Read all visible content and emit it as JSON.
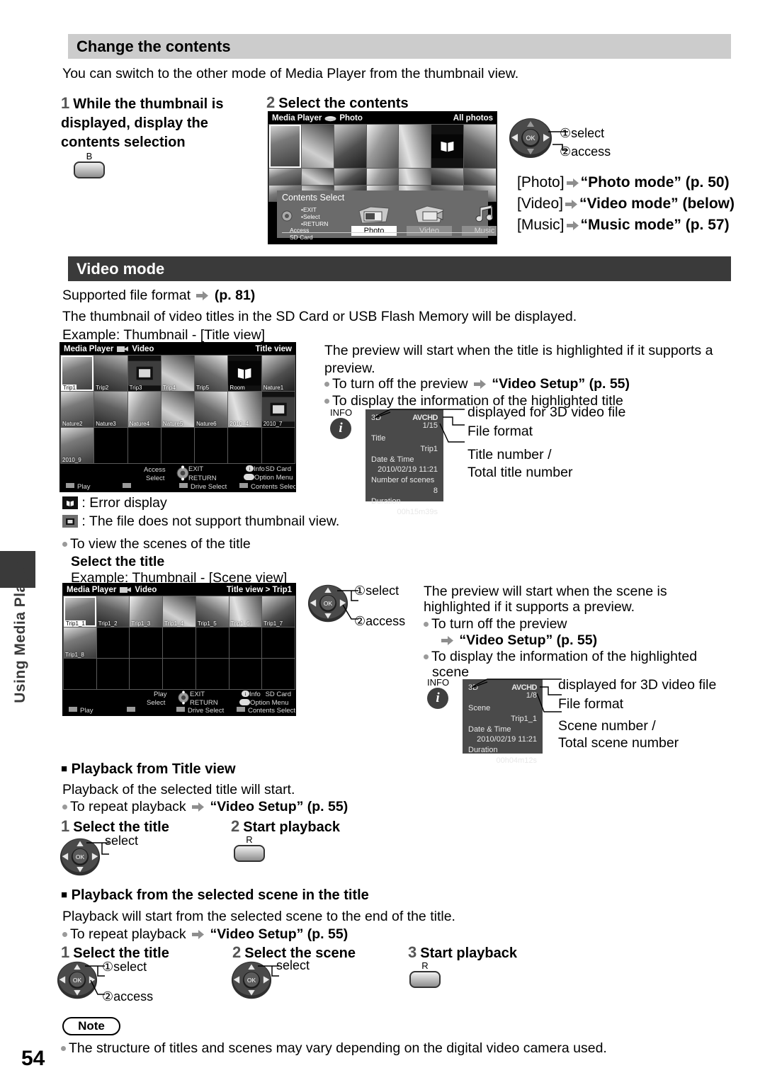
{
  "sidebar": {
    "tab_label": "Using Media Player"
  },
  "sections": {
    "change_contents": {
      "heading": "Change the contents",
      "intro": "You can switch to the other mode of Media Player from the thumbnail view.",
      "step1": {
        "num": "1",
        "text": "While the thumbnail is displayed, display the contents selection",
        "button_label": "B"
      },
      "step2": {
        "num": "2",
        "text": "Select the contents",
        "dpad_note1": "select",
        "dpad_note1_num": "①",
        "dpad_note2": "access",
        "dpad_note2_num": "②"
      },
      "mode_links": [
        {
          "bracket": "[Photo]",
          "label": "“Photo mode”",
          "page": "(p. 50)"
        },
        {
          "bracket": "[Video]",
          "label": "“Video mode”",
          "page": "(below)"
        },
        {
          "bracket": "[Music]",
          "label": "“Music mode”",
          "page": "(p. 57)"
        }
      ]
    },
    "video_mode": {
      "heading": "Video mode",
      "supported": "Supported file format",
      "supported_page": "(p. 81)",
      "thumb_line": "The thumbnail of video titles in the SD Card or USB Flash Memory will be displayed.",
      "example_title": "Example: Thumbnail - [Title view]",
      "example_scene": "Example: Thumbnail - [Scene view]",
      "preview_title": "The preview will start when the title is highlighted if it supports a preview.",
      "bullet_turnoff": "To turn off the preview",
      "video_setup": "“Video Setup”",
      "video_setup_page": "(p. 55)",
      "bullet_info_title": "To display the information of the highlighted title",
      "error_display": ": Error display",
      "no_thumb": ": The file does not support thumbnail view.",
      "bullet_view_scenes": "To view the scenes of the title",
      "select_title": "Select the title",
      "preview_scene_l1": "The preview will start when the scene is",
      "preview_scene_l2": "highlighted if it supports a preview.",
      "bullet_info_scene_l1": "To display the information of the highlighted",
      "bullet_info_scene_l2": "scene"
    }
  },
  "title_view_screen": {
    "app_name": "Media Player",
    "mode": "Video",
    "view_label": "Title view",
    "thumbs": [
      {
        "label": "Trip1",
        "kind": "photo",
        "selected": true
      },
      {
        "label": "Trip2",
        "kind": "photo"
      },
      {
        "label": "Trip3",
        "kind": "nothumb"
      },
      {
        "label": "Trip4",
        "kind": "photo"
      },
      {
        "label": "Trip5",
        "kind": "photo"
      },
      {
        "label": "Room",
        "kind": "error"
      },
      {
        "label": "Nature1",
        "kind": "photo"
      },
      {
        "label": "Nature2",
        "kind": "photo"
      },
      {
        "label": "Nature3",
        "kind": "photo"
      },
      {
        "label": "Nature4",
        "kind": "photo"
      },
      {
        "label": "Nature5",
        "kind": "photo"
      },
      {
        "label": "Nature6",
        "kind": "photo"
      },
      {
        "label": "2010_4",
        "kind": "photo"
      },
      {
        "label": "2010_7",
        "kind": "nothumb"
      },
      {
        "label": "2010_9",
        "kind": "photo"
      },
      {
        "label": "",
        "kind": "empty"
      },
      {
        "label": "",
        "kind": "empty"
      },
      {
        "label": "",
        "kind": "empty"
      },
      {
        "label": "",
        "kind": "empty"
      },
      {
        "label": "",
        "kind": "empty"
      },
      {
        "label": "",
        "kind": "empty"
      }
    ],
    "footer": {
      "access": "Access",
      "select": "Select",
      "exit": "EXIT",
      "return": "RETURN",
      "info": "Info",
      "option_menu": "Option Menu",
      "drive": "SD Card",
      "play": "Play",
      "drive_select": "Drive Select",
      "contents_select": "Contents Select"
    }
  },
  "scene_view_screen": {
    "app_name": "Media Player",
    "mode": "Video",
    "view_label": "Title view  >  Trip1",
    "thumbs": [
      {
        "label": "Trip1_1",
        "kind": "photo",
        "selected": true
      },
      {
        "label": "Trip1_2",
        "kind": "photo"
      },
      {
        "label": "Trip1_3",
        "kind": "photo"
      },
      {
        "label": "Trip1_4",
        "kind": "photo"
      },
      {
        "label": "Trip1_5",
        "kind": "photo"
      },
      {
        "label": "Trip1_6",
        "kind": "photo"
      },
      {
        "label": "Trip1_7",
        "kind": "photo"
      },
      {
        "label": "Trip1_8",
        "kind": "photo"
      },
      {
        "label": "",
        "kind": "empty"
      },
      {
        "label": "",
        "kind": "empty"
      },
      {
        "label": "",
        "kind": "empty"
      },
      {
        "label": "",
        "kind": "empty"
      },
      {
        "label": "",
        "kind": "empty"
      },
      {
        "label": "",
        "kind": "empty"
      },
      {
        "label": "",
        "kind": "empty"
      },
      {
        "label": "",
        "kind": "empty"
      },
      {
        "label": "",
        "kind": "empty"
      },
      {
        "label": "",
        "kind": "empty"
      },
      {
        "label": "",
        "kind": "empty"
      },
      {
        "label": "",
        "kind": "empty"
      },
      {
        "label": "",
        "kind": "empty"
      }
    ],
    "footer": {
      "access": "Play",
      "select": "Select",
      "exit": "EXIT",
      "return": "RETURN",
      "info": "Info",
      "option_menu": "Option Menu",
      "drive": "SD Card",
      "play": "Play",
      "drive_select": "Drive Select",
      "contents_select": "Contents Select"
    }
  },
  "photo_screen": {
    "app_name": "Media Player",
    "mode": "Photo",
    "view_label": "All photos",
    "overlay_title": "Contents Select",
    "overlay_hints": {
      "exit": "EXIT",
      "select": "Select",
      "return": "RETURN",
      "access": "Access",
      "drive": "SD Card"
    },
    "options": [
      {
        "label": "Photo",
        "selected": true
      },
      {
        "label": "Video",
        "selected": false
      },
      {
        "label": "Music",
        "selected": false
      }
    ]
  },
  "info_title": {
    "badge": "INFO",
    "flag_3d": "3D",
    "format": "AVCHD",
    "counter": "1/15",
    "rows": [
      {
        "key": "Title",
        "val": "Trip1"
      },
      {
        "key": "Date & Time",
        "val": "2010/02/19 11:21"
      },
      {
        "key": "Number of scenes",
        "val": "8"
      },
      {
        "key": "Duration",
        "val": "00h15m39s"
      }
    ],
    "callouts": {
      "three_d": "displayed for 3D video file",
      "format": "File format",
      "number_l1": "Title number /",
      "number_l2": "Total title number"
    }
  },
  "info_scene": {
    "badge": "INFO",
    "flag_3d": "3D",
    "format": "AVCHD",
    "counter": "1/8",
    "rows": [
      {
        "key": "Scene",
        "val": "Trip1_1"
      },
      {
        "key": "Date & Time",
        "val": "2010/02/19 11:21"
      },
      {
        "key": "Duration",
        "val": "00h04m12s"
      }
    ],
    "callouts": {
      "three_d": "displayed for 3D video file",
      "format": "File format",
      "number_l1": "Scene number /",
      "number_l2": "Total scene number"
    }
  },
  "playback_title": {
    "heading": "Playback from Title view",
    "body": "Playback of the selected title will start.",
    "bullet_repeat": "To repeat playback",
    "video_setup": "“Video Setup”",
    "video_setup_page": "(p. 55)",
    "steps": [
      {
        "num": "1",
        "label": "Select the title",
        "note": "select"
      },
      {
        "num": "2",
        "label": "Start playback",
        "button": "R"
      }
    ]
  },
  "playback_scene": {
    "heading": "Playback from the selected scene in the title",
    "body": "Playback will start from the selected scene to the end of the title.",
    "bullet_repeat": "To repeat playback",
    "video_setup": "“Video Setup”",
    "video_setup_page": "(p. 55)",
    "steps": [
      {
        "num": "1",
        "label": "Select the title",
        "note1": "①",
        "note1_txt": "select",
        "note2": "②",
        "note2_txt": "access"
      },
      {
        "num": "2",
        "label": "Select the scene",
        "note": "select"
      },
      {
        "num": "3",
        "label": "Start playback",
        "button": "R"
      }
    ]
  },
  "note": {
    "pill": "Note",
    "text": "The structure of titles and scenes may vary depending on the digital video camera used."
  },
  "page_number": "54",
  "colors": {
    "header_grey": "#cccccc",
    "header_dark": "#3a3a3a",
    "tv_panel": "#5a5a5a",
    "info_panel": "#4a4a4a"
  }
}
